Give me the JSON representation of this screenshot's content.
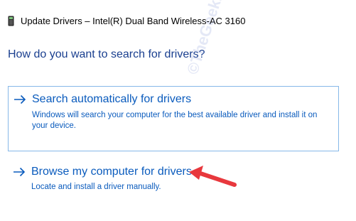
{
  "window": {
    "title": "Update Drivers – Intel(R) Dual Band Wireless-AC 3160",
    "icon": "device-icon"
  },
  "prompt": "How do you want to search for drivers?",
  "options": [
    {
      "title": "Search automatically for drivers",
      "description": "Windows will search your computer for the best available driver and install it on your device.",
      "icon": "arrow-right-icon"
    },
    {
      "title": "Browse my computer for drivers",
      "description": "Locate and install a driver manually.",
      "icon": "arrow-right-icon"
    }
  ],
  "watermark": "©TheGeekPage.com",
  "colors": {
    "link": "#0a5bbd",
    "heading": "#1a3f8f",
    "border": "#86b8e8",
    "annotation_arrow": "#e8383d"
  }
}
